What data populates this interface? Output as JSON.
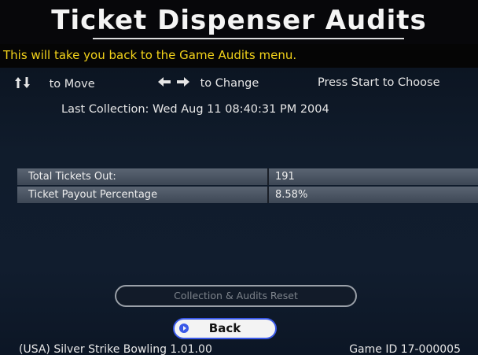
{
  "header": {
    "title": "Ticket Dispenser Audits",
    "help_text": "This will take you back to the Game Audits menu."
  },
  "nav": {
    "move_icon": "up-down-arrows",
    "move_label": "to Move",
    "change_icon": "left-right-arrows",
    "change_label": "to Change",
    "choose_label": "Press Start to Choose"
  },
  "last_collection": "Last Collection: Wed Aug 11 08:40:31 PM 2004",
  "stats": [
    {
      "label": "Total Tickets Out:",
      "value": "191"
    },
    {
      "label": "Ticket Payout Percentage",
      "value": "8.58%"
    }
  ],
  "buttons": {
    "reset_label": "Collection & Audits Reset",
    "back_label": "Back"
  },
  "footer": {
    "game_name": "(USA) Silver Strike Bowling 1.01.00",
    "game_id": "Game ID 17-000005"
  },
  "colors": {
    "help_text": "#f2d21a",
    "back_border": "#3a59e8"
  }
}
